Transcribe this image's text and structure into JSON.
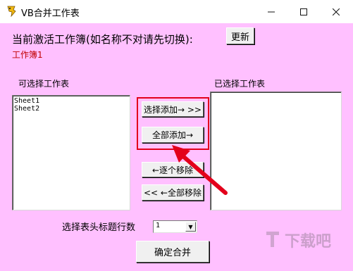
{
  "window": {
    "title": "VB合并工作表",
    "controls": [
      "minimize",
      "maximize",
      "close"
    ]
  },
  "header": {
    "prompt": "当前激活工作簿(如名称不对请先切换):",
    "refresh_label": "更新",
    "workbook_name": "工作簿1"
  },
  "available": {
    "label": "可选择工作表",
    "items": [
      "Sheet1",
      "Sheet2"
    ]
  },
  "selected": {
    "label": "已选择工作表",
    "items": []
  },
  "buttons": {
    "add_selected": "选择添加→ >>",
    "add_all": "全部添加→",
    "remove_one": "←逐个移除",
    "remove_all": "<< ←全部移除",
    "confirm": "确定合并"
  },
  "header_rows": {
    "label": "选择表头标题行数",
    "value": "1"
  },
  "colors": {
    "client_background": "#ffc0ff",
    "highlight": "#e3001b",
    "workbook_text": "#c00000"
  },
  "watermark": "下载吧"
}
